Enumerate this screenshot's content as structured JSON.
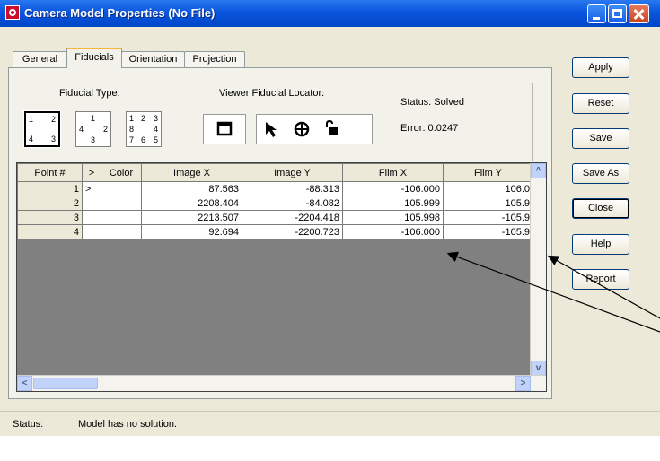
{
  "window": {
    "title": "Camera Model Properties (No File)"
  },
  "tabs": [
    {
      "label": "General"
    },
    {
      "label": "Fiducials"
    },
    {
      "label": "Orientation"
    },
    {
      "label": "Projection"
    }
  ],
  "fiducial_type": {
    "label": "Fiducial Type:",
    "options": [
      {
        "numbers": [
          "1",
          "2",
          "4",
          "3"
        ]
      },
      {
        "numbers": [
          "1",
          "4",
          "2",
          "3"
        ]
      },
      {
        "numbers": [
          "1",
          "2",
          "3",
          "8",
          "4",
          "7",
          "6",
          "5"
        ]
      }
    ]
  },
  "locator": {
    "label": "Viewer Fiducial Locator:"
  },
  "status_panel": {
    "status_text": "Status: Solved",
    "error_text": "Error: 0.0247"
  },
  "grid": {
    "headers": [
      "Point #",
      ">",
      "Color",
      "Image X",
      "Image Y",
      "Film X",
      "Film Y"
    ],
    "rows": [
      {
        "point": "1",
        "marker": ">",
        "color": "",
        "image_x": "87.563",
        "image_y": "-88.313",
        "film_x": "-106.000",
        "film_y": "106.0"
      },
      {
        "point": "2",
        "marker": "",
        "color": "",
        "image_x": "2208.404",
        "image_y": "-84.082",
        "film_x": "105.999",
        "film_y": "105.9"
      },
      {
        "point": "3",
        "marker": "",
        "color": "",
        "image_x": "2213.507",
        "image_y": "-2204.418",
        "film_x": "105.998",
        "film_y": "-105.9"
      },
      {
        "point": "4",
        "marker": "",
        "color": "",
        "image_x": "92.694",
        "image_y": "-2200.723",
        "film_x": "-106.000",
        "film_y": "-105.9"
      }
    ]
  },
  "side_buttons": [
    "Apply",
    "Reset",
    "Save",
    "Save As",
    "Close",
    "Help",
    "Report"
  ],
  "status_bar": {
    "label": "Status:",
    "message": "Model has no solution."
  },
  "colors": {
    "titlebar": "#0a56de",
    "face": "#ece9d8",
    "active_tab_accent": "#f7b53a",
    "grid_empty": "#808080"
  }
}
